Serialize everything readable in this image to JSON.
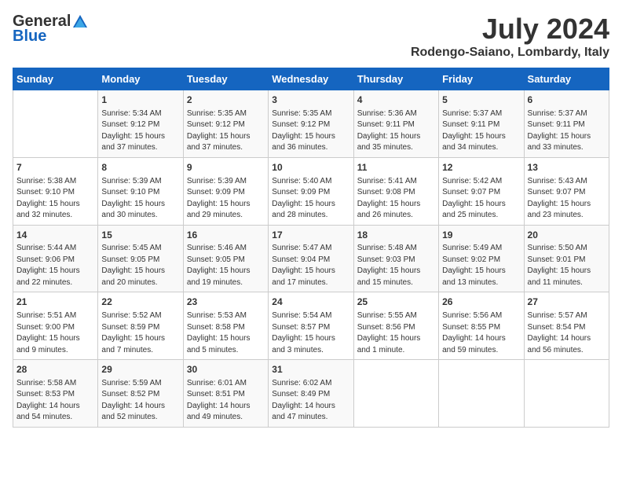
{
  "logo": {
    "general": "General",
    "blue": "Blue"
  },
  "title": {
    "month_year": "July 2024",
    "location": "Rodengo-Saiano, Lombardy, Italy"
  },
  "calendar": {
    "headers": [
      "Sunday",
      "Monday",
      "Tuesday",
      "Wednesday",
      "Thursday",
      "Friday",
      "Saturday"
    ],
    "weeks": [
      [
        {
          "day": "",
          "content": ""
        },
        {
          "day": "1",
          "content": "Sunrise: 5:34 AM\nSunset: 9:12 PM\nDaylight: 15 hours\nand 37 minutes."
        },
        {
          "day": "2",
          "content": "Sunrise: 5:35 AM\nSunset: 9:12 PM\nDaylight: 15 hours\nand 37 minutes."
        },
        {
          "day": "3",
          "content": "Sunrise: 5:35 AM\nSunset: 9:12 PM\nDaylight: 15 hours\nand 36 minutes."
        },
        {
          "day": "4",
          "content": "Sunrise: 5:36 AM\nSunset: 9:11 PM\nDaylight: 15 hours\nand 35 minutes."
        },
        {
          "day": "5",
          "content": "Sunrise: 5:37 AM\nSunset: 9:11 PM\nDaylight: 15 hours\nand 34 minutes."
        },
        {
          "day": "6",
          "content": "Sunrise: 5:37 AM\nSunset: 9:11 PM\nDaylight: 15 hours\nand 33 minutes."
        }
      ],
      [
        {
          "day": "7",
          "content": "Sunrise: 5:38 AM\nSunset: 9:10 PM\nDaylight: 15 hours\nand 32 minutes."
        },
        {
          "day": "8",
          "content": "Sunrise: 5:39 AM\nSunset: 9:10 PM\nDaylight: 15 hours\nand 30 minutes."
        },
        {
          "day": "9",
          "content": "Sunrise: 5:39 AM\nSunset: 9:09 PM\nDaylight: 15 hours\nand 29 minutes."
        },
        {
          "day": "10",
          "content": "Sunrise: 5:40 AM\nSunset: 9:09 PM\nDaylight: 15 hours\nand 28 minutes."
        },
        {
          "day": "11",
          "content": "Sunrise: 5:41 AM\nSunset: 9:08 PM\nDaylight: 15 hours\nand 26 minutes."
        },
        {
          "day": "12",
          "content": "Sunrise: 5:42 AM\nSunset: 9:07 PM\nDaylight: 15 hours\nand 25 minutes."
        },
        {
          "day": "13",
          "content": "Sunrise: 5:43 AM\nSunset: 9:07 PM\nDaylight: 15 hours\nand 23 minutes."
        }
      ],
      [
        {
          "day": "14",
          "content": "Sunrise: 5:44 AM\nSunset: 9:06 PM\nDaylight: 15 hours\nand 22 minutes."
        },
        {
          "day": "15",
          "content": "Sunrise: 5:45 AM\nSunset: 9:05 PM\nDaylight: 15 hours\nand 20 minutes."
        },
        {
          "day": "16",
          "content": "Sunrise: 5:46 AM\nSunset: 9:05 PM\nDaylight: 15 hours\nand 19 minutes."
        },
        {
          "day": "17",
          "content": "Sunrise: 5:47 AM\nSunset: 9:04 PM\nDaylight: 15 hours\nand 17 minutes."
        },
        {
          "day": "18",
          "content": "Sunrise: 5:48 AM\nSunset: 9:03 PM\nDaylight: 15 hours\nand 15 minutes."
        },
        {
          "day": "19",
          "content": "Sunrise: 5:49 AM\nSunset: 9:02 PM\nDaylight: 15 hours\nand 13 minutes."
        },
        {
          "day": "20",
          "content": "Sunrise: 5:50 AM\nSunset: 9:01 PM\nDaylight: 15 hours\nand 11 minutes."
        }
      ],
      [
        {
          "day": "21",
          "content": "Sunrise: 5:51 AM\nSunset: 9:00 PM\nDaylight: 15 hours\nand 9 minutes."
        },
        {
          "day": "22",
          "content": "Sunrise: 5:52 AM\nSunset: 8:59 PM\nDaylight: 15 hours\nand 7 minutes."
        },
        {
          "day": "23",
          "content": "Sunrise: 5:53 AM\nSunset: 8:58 PM\nDaylight: 15 hours\nand 5 minutes."
        },
        {
          "day": "24",
          "content": "Sunrise: 5:54 AM\nSunset: 8:57 PM\nDaylight: 15 hours\nand 3 minutes."
        },
        {
          "day": "25",
          "content": "Sunrise: 5:55 AM\nSunset: 8:56 PM\nDaylight: 15 hours\nand 1 minute."
        },
        {
          "day": "26",
          "content": "Sunrise: 5:56 AM\nSunset: 8:55 PM\nDaylight: 14 hours\nand 59 minutes."
        },
        {
          "day": "27",
          "content": "Sunrise: 5:57 AM\nSunset: 8:54 PM\nDaylight: 14 hours\nand 56 minutes."
        }
      ],
      [
        {
          "day": "28",
          "content": "Sunrise: 5:58 AM\nSunset: 8:53 PM\nDaylight: 14 hours\nand 54 minutes."
        },
        {
          "day": "29",
          "content": "Sunrise: 5:59 AM\nSunset: 8:52 PM\nDaylight: 14 hours\nand 52 minutes."
        },
        {
          "day": "30",
          "content": "Sunrise: 6:01 AM\nSunset: 8:51 PM\nDaylight: 14 hours\nand 49 minutes."
        },
        {
          "day": "31",
          "content": "Sunrise: 6:02 AM\nSunset: 8:49 PM\nDaylight: 14 hours\nand 47 minutes."
        },
        {
          "day": "",
          "content": ""
        },
        {
          "day": "",
          "content": ""
        },
        {
          "day": "",
          "content": ""
        }
      ]
    ]
  }
}
